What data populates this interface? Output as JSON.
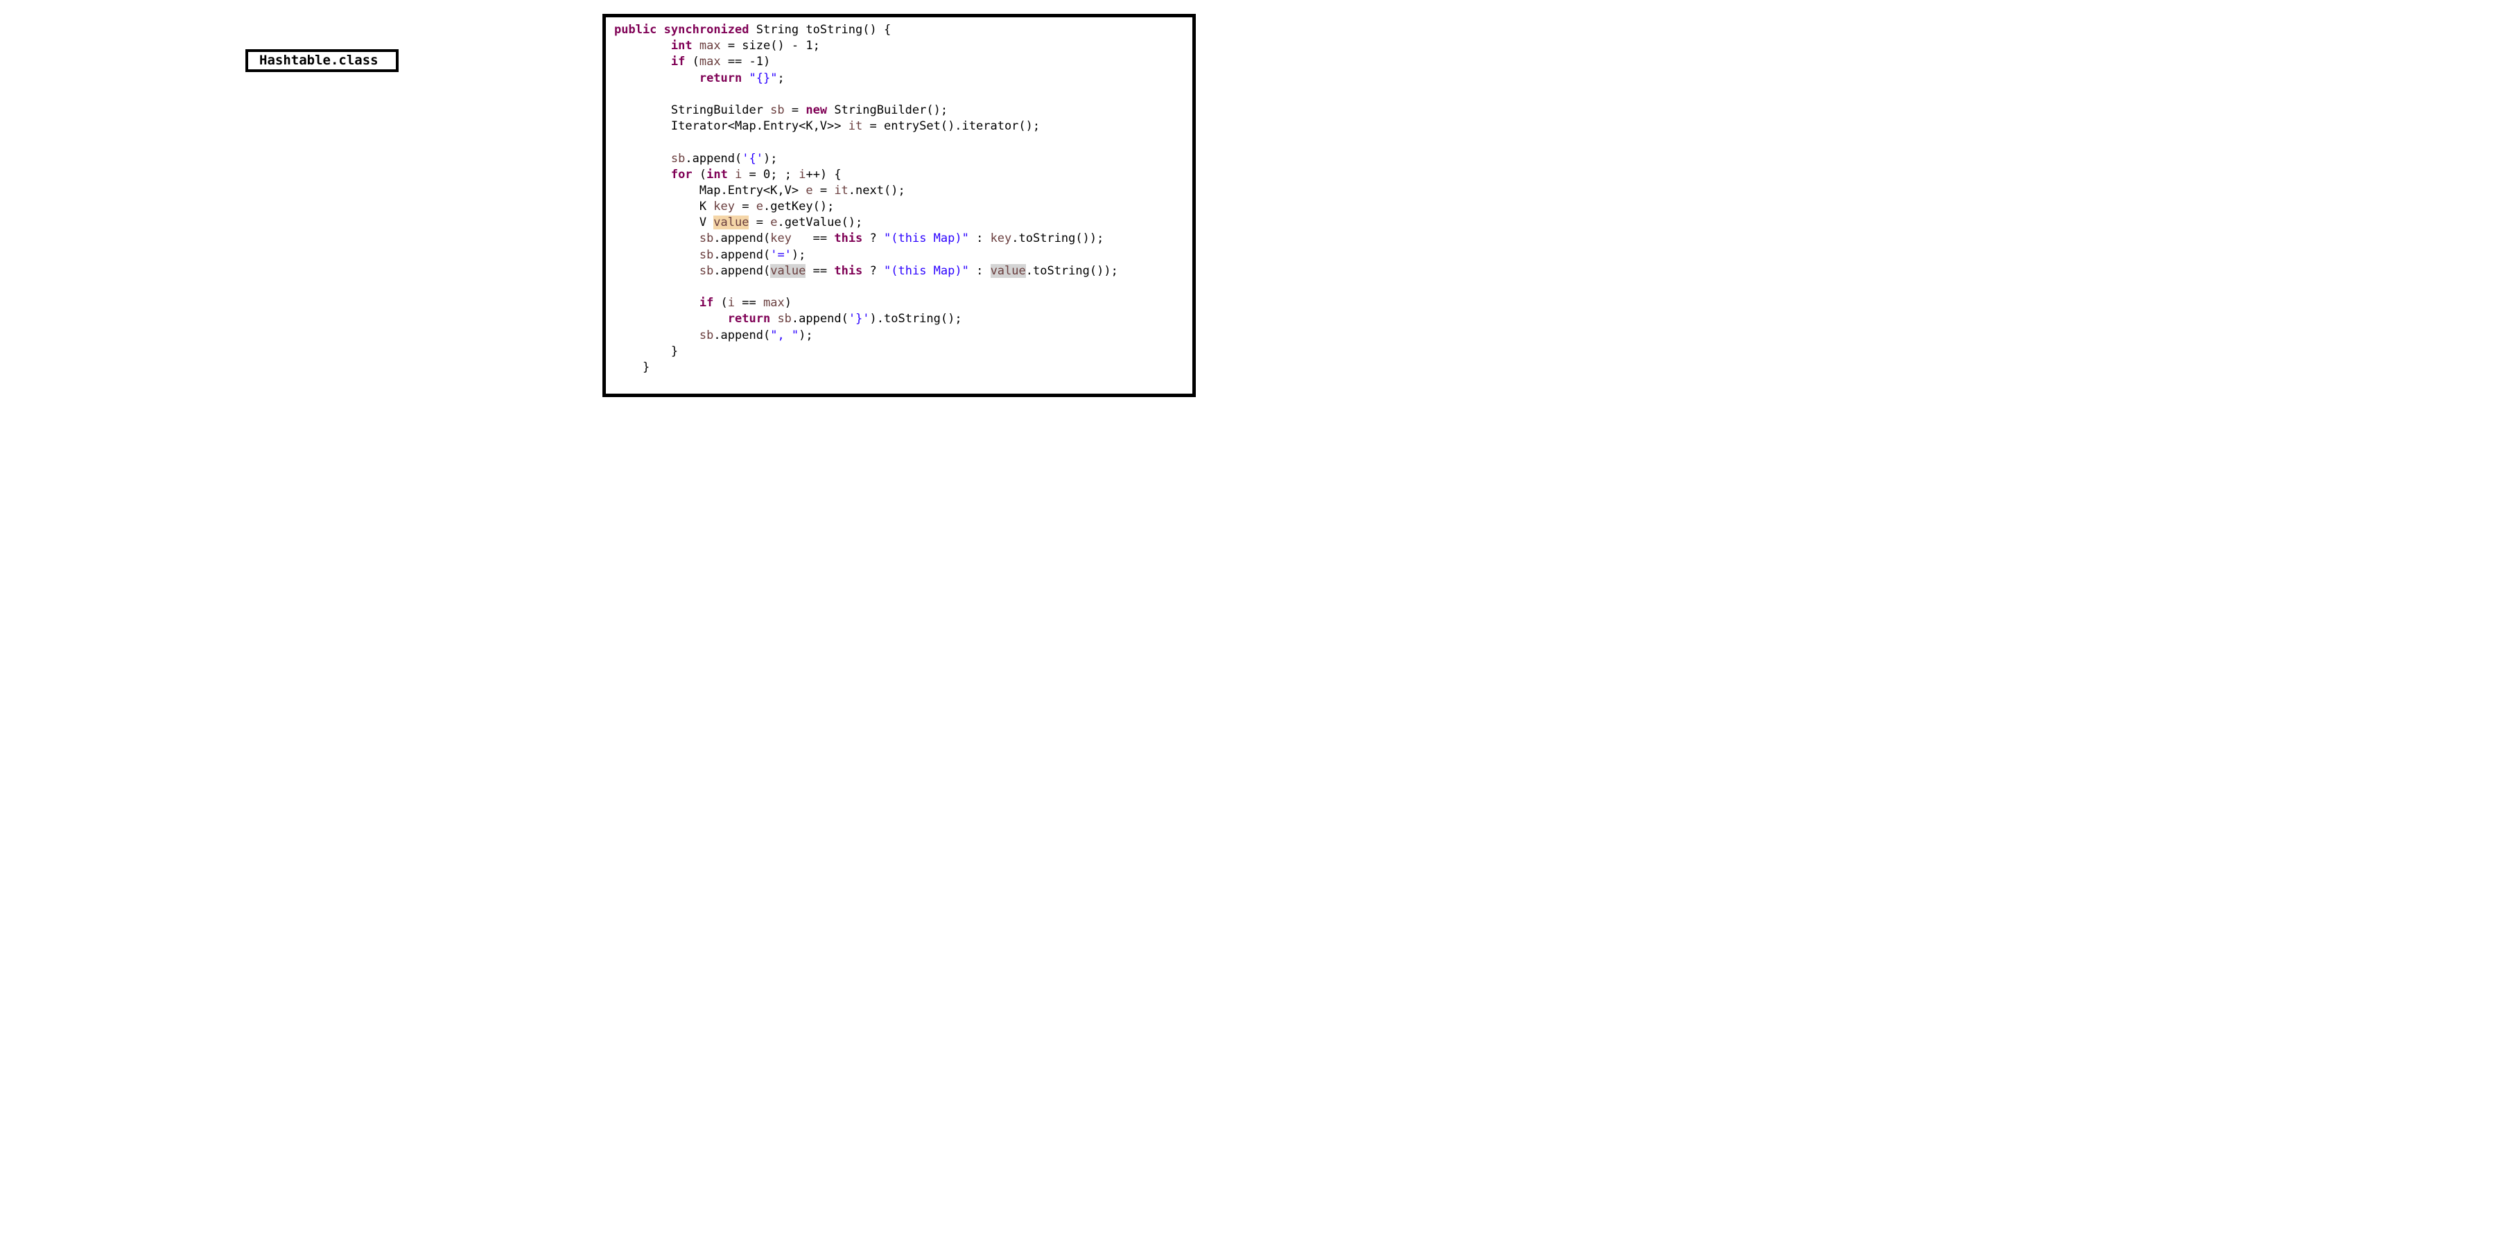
{
  "label_box": {
    "text": "Hashtable.class"
  },
  "code": {
    "lines": [
      {
        "tokens": [
          {
            "t": "public",
            "k": "kw"
          },
          {
            "t": " "
          },
          {
            "t": "synchronized",
            "k": "kw"
          },
          {
            "t": " String toString() {"
          }
        ]
      },
      {
        "tokens": [
          {
            "t": "        "
          },
          {
            "t": "int",
            "k": "kw"
          },
          {
            "t": " "
          },
          {
            "t": "max",
            "k": "var"
          },
          {
            "t": " = size() - 1;"
          }
        ]
      },
      {
        "tokens": [
          {
            "t": "        "
          },
          {
            "t": "if",
            "k": "kw"
          },
          {
            "t": " ("
          },
          {
            "t": "max",
            "k": "var"
          },
          {
            "t": " == -1)"
          }
        ]
      },
      {
        "tokens": [
          {
            "t": "            "
          },
          {
            "t": "return",
            "k": "kw"
          },
          {
            "t": " "
          },
          {
            "t": "\"{}\"",
            "k": "str"
          },
          {
            "t": ";"
          }
        ]
      },
      {
        "tokens": [
          {
            "t": ""
          }
        ]
      },
      {
        "tokens": [
          {
            "t": "        StringBuilder "
          },
          {
            "t": "sb",
            "k": "var"
          },
          {
            "t": " = "
          },
          {
            "t": "new",
            "k": "kw"
          },
          {
            "t": " StringBuilder();"
          }
        ]
      },
      {
        "tokens": [
          {
            "t": "        Iterator<Map.Entry<K,V>> "
          },
          {
            "t": "it",
            "k": "var"
          },
          {
            "t": " = entrySet().iterator();"
          }
        ]
      },
      {
        "tokens": [
          {
            "t": ""
          }
        ]
      },
      {
        "tokens": [
          {
            "t": "        "
          },
          {
            "t": "sb",
            "k": "var"
          },
          {
            "t": ".append("
          },
          {
            "t": "'{'",
            "k": "str"
          },
          {
            "t": ");"
          }
        ]
      },
      {
        "tokens": [
          {
            "t": "        "
          },
          {
            "t": "for",
            "k": "kw"
          },
          {
            "t": " ("
          },
          {
            "t": "int",
            "k": "kw"
          },
          {
            "t": " "
          },
          {
            "t": "i",
            "k": "var"
          },
          {
            "t": " = 0; ; "
          },
          {
            "t": "i",
            "k": "var"
          },
          {
            "t": "++) {"
          }
        ]
      },
      {
        "tokens": [
          {
            "t": "            Map.Entry<K,V> "
          },
          {
            "t": "e",
            "k": "var"
          },
          {
            "t": " = "
          },
          {
            "t": "it",
            "k": "var"
          },
          {
            "t": ".next();"
          }
        ]
      },
      {
        "tokens": [
          {
            "t": "            K "
          },
          {
            "t": "key",
            "k": "var"
          },
          {
            "t": " = "
          },
          {
            "t": "e",
            "k": "var"
          },
          {
            "t": ".getKey();"
          }
        ]
      },
      {
        "tokens": [
          {
            "t": "            V "
          },
          {
            "t": "value",
            "k": "var hl-occ"
          },
          {
            "t": " = "
          },
          {
            "t": "e",
            "k": "var"
          },
          {
            "t": ".getValue();"
          }
        ]
      },
      {
        "tokens": [
          {
            "t": "            "
          },
          {
            "t": "sb",
            "k": "var"
          },
          {
            "t": ".append("
          },
          {
            "t": "key",
            "k": "var"
          },
          {
            "t": "   == "
          },
          {
            "t": "this",
            "k": "kw"
          },
          {
            "t": " ? "
          },
          {
            "t": "\"(this Map)\"",
            "k": "str"
          },
          {
            "t": " : "
          },
          {
            "t": "key",
            "k": "var"
          },
          {
            "t": ".toString());"
          }
        ]
      },
      {
        "tokens": [
          {
            "t": "            "
          },
          {
            "t": "sb",
            "k": "var"
          },
          {
            "t": ".append("
          },
          {
            "t": "'='",
            "k": "str"
          },
          {
            "t": ");"
          }
        ]
      },
      {
        "tokens": [
          {
            "t": "            "
          },
          {
            "t": "sb",
            "k": "var"
          },
          {
            "t": ".append("
          },
          {
            "t": "value",
            "k": "var hl-ref"
          },
          {
            "t": " == "
          },
          {
            "t": "this",
            "k": "kw"
          },
          {
            "t": " ? "
          },
          {
            "t": "\"(this Map)\"",
            "k": "str"
          },
          {
            "t": " : "
          },
          {
            "t": "value",
            "k": "var hl-ref"
          },
          {
            "t": ".toString());"
          }
        ]
      },
      {
        "tokens": [
          {
            "t": ""
          }
        ]
      },
      {
        "tokens": [
          {
            "t": "            "
          },
          {
            "t": "if",
            "k": "kw"
          },
          {
            "t": " ("
          },
          {
            "t": "i",
            "k": "var"
          },
          {
            "t": " == "
          },
          {
            "t": "max",
            "k": "var"
          },
          {
            "t": ")"
          }
        ]
      },
      {
        "tokens": [
          {
            "t": "                "
          },
          {
            "t": "return",
            "k": "kw"
          },
          {
            "t": " "
          },
          {
            "t": "sb",
            "k": "var"
          },
          {
            "t": ".append("
          },
          {
            "t": "'}'",
            "k": "str"
          },
          {
            "t": ").toString();"
          }
        ]
      },
      {
        "tokens": [
          {
            "t": "            "
          },
          {
            "t": "sb",
            "k": "var"
          },
          {
            "t": ".append("
          },
          {
            "t": "\", \"",
            "k": "str"
          },
          {
            "t": ");"
          }
        ]
      },
      {
        "tokens": [
          {
            "t": "        }"
          }
        ]
      },
      {
        "tokens": [
          {
            "t": "    }"
          }
        ]
      }
    ]
  }
}
